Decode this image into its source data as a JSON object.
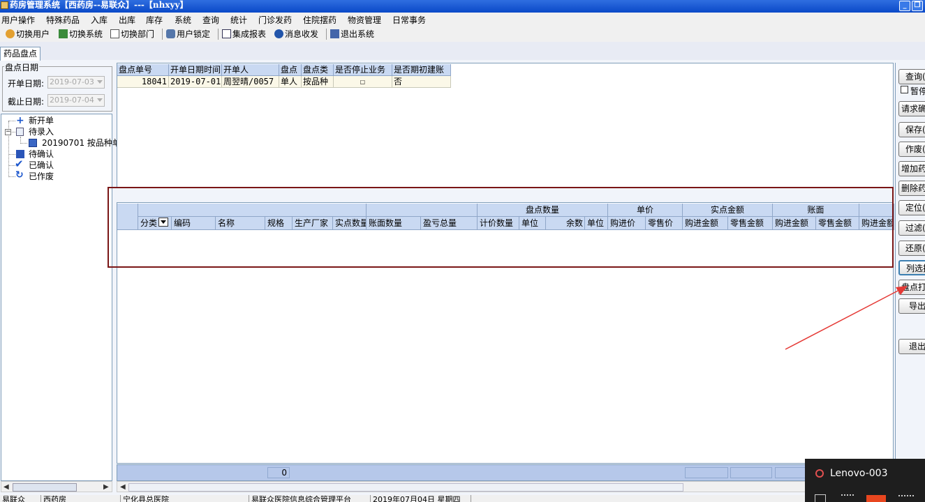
{
  "title_bar": {
    "title": "药房管理系统【西药房--易联众】---【nhxyy】",
    "min": "_",
    "restore": "❐"
  },
  "menu": [
    "用户操作",
    "特殊药品",
    "入库",
    "出库",
    "库存",
    "系统",
    "查询",
    "统计",
    "门诊发药",
    "住院摆药",
    "物资管理",
    "日常事务"
  ],
  "toolbar": [
    "切换用户",
    "切换系统",
    "切换部门",
    "用户锁定",
    "集成报表",
    "消息收发",
    "退出系统"
  ],
  "tab": {
    "label": "药品盘点"
  },
  "left": {
    "group_label": "盘点日期",
    "start_label": "开单日期:",
    "start_value": "2019-07-03",
    "end_label": "截止日期:",
    "end_value": "2019-07-04",
    "tree": {
      "new": "新开单",
      "pending_entry": "待录入",
      "pending_child": "20190701 按品种单",
      "pending_confirm": "待确认",
      "confirmed": "已确认",
      "voided": "已作废"
    }
  },
  "top_grid": {
    "headers": [
      "盘点单号",
      "开单日期时间",
      "开单人",
      "盘点",
      "盘点类",
      "是否停止业务",
      "是否期初建账"
    ],
    "rows": [
      {
        "id": "18041",
        "date": "2019-07-01",
        "creator": "周翌晴/0057",
        "type": "单人",
        "kind": "按品种",
        "stop": "☐",
        "initial": "否"
      }
    ]
  },
  "bottom_grid": {
    "group_headers": {
      "count": "盘点数量",
      "price": "单价",
      "actual_amount": "实点金额",
      "book": "账面"
    },
    "headers": [
      "分类",
      "编码",
      "名称",
      "规格",
      "生产厂家",
      "实点数量",
      "账面数量",
      "盈亏总量",
      "计价数量",
      "单位",
      "余数",
      "单位",
      "购进价",
      "零售价",
      "购进金额",
      "零售金额",
      "购进金额",
      "零售金额",
      "购进金额"
    ],
    "summary_value": "0"
  },
  "right_buttons": [
    "查询(",
    "暂停",
    "请求确",
    "保存(",
    "作废(",
    "增加药",
    "删除药",
    "定位(",
    "过滤(",
    "还原(",
    "列选择",
    "盘点打",
    "导出",
    "退出"
  ],
  "status_bar": [
    "易联众",
    "西药房",
    "宁化县总医院",
    "易联众医院信息综合管理平台",
    "2019年07月04日 星期四"
  ],
  "notification": {
    "device": "Lenovo-003"
  }
}
